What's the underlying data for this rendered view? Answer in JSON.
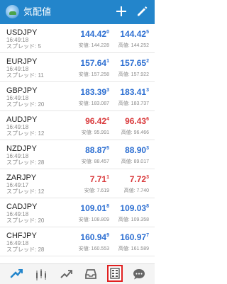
{
  "app_bar": {
    "title": "気配値",
    "logo_icon": "app-logo",
    "add_icon": "plus-icon",
    "edit_icon": "pencil-icon",
    "background": "#2385cb"
  },
  "colors": {
    "up": "#2d6fd2",
    "down": "#d9383a"
  },
  "quotes": [
    {
      "symbol": "USDJPY",
      "time": "16:49:18",
      "spread": "スプレッド: 5",
      "bid_main": "144.42",
      "bid_sup": "0",
      "ask_main": "144.42",
      "ask_sup": "5",
      "low": "安値: 144.228",
      "high": "高値: 144.252",
      "direction": "up"
    },
    {
      "symbol": "EURJPY",
      "time": "16:49:18",
      "spread": "スプレッド: 11",
      "bid_main": "157.64",
      "bid_sup": "1",
      "ask_main": "157.65",
      "ask_sup": "2",
      "low": "安値: 157.258",
      "high": "高値: 157.922",
      "direction": "up"
    },
    {
      "symbol": "GBPJPY",
      "time": "16:49:18",
      "spread": "スプレッド: 20",
      "bid_main": "183.39",
      "bid_sup": "3",
      "ask_main": "183.41",
      "ask_sup": "3",
      "low": "安値: 183.087",
      "high": "高値: 183.737",
      "direction": "up"
    },
    {
      "symbol": "AUDJPY",
      "time": "16:49:18",
      "spread": "スプレッド: 12",
      "bid_main": "96.42",
      "bid_sup": "4",
      "ask_main": "96.43",
      "ask_sup": "6",
      "low": "安値: 95.991",
      "high": "高値: 96.466",
      "direction": "down"
    },
    {
      "symbol": "NZDJPY",
      "time": "16:49:18",
      "spread": "スプレッド: 28",
      "bid_main": "88.87",
      "bid_sup": "5",
      "ask_main": "88.90",
      "ask_sup": "3",
      "low": "安値: 88.457",
      "high": "高値: 89.017",
      "direction": "up"
    },
    {
      "symbol": "ZARJPY",
      "time": "16:49:17",
      "spread": "スプレッド: 12",
      "bid_main": "7.71",
      "bid_sup": "1",
      "ask_main": "7.72",
      "ask_sup": "3",
      "low": "安値: 7.619",
      "high": "高値: 7.740",
      "direction": "down"
    },
    {
      "symbol": "CADJPY",
      "time": "16:49:18",
      "spread": "スプレッド: 20",
      "bid_main": "109.01",
      "bid_sup": "8",
      "ask_main": "109.03",
      "ask_sup": "8",
      "low": "安値: 108.809",
      "high": "高値: 109.358",
      "direction": "up"
    },
    {
      "symbol": "CHFJPY",
      "time": "16:49:18",
      "spread": "スプレッド: 28",
      "bid_main": "160.94",
      "bid_sup": "9",
      "ask_main": "160.97",
      "ask_sup": "7",
      "low": "安値: 160.553",
      "high": "高値: 161.589",
      "direction": "up"
    }
  ],
  "bottom_nav": {
    "items": [
      {
        "icon": "trade-icon"
      },
      {
        "icon": "chart-icon"
      },
      {
        "icon": "trend-icon"
      },
      {
        "icon": "inbox-icon"
      },
      {
        "icon": "quotes-icon",
        "active": true
      },
      {
        "icon": "chat-icon"
      }
    ],
    "active_border": "#e02020"
  }
}
